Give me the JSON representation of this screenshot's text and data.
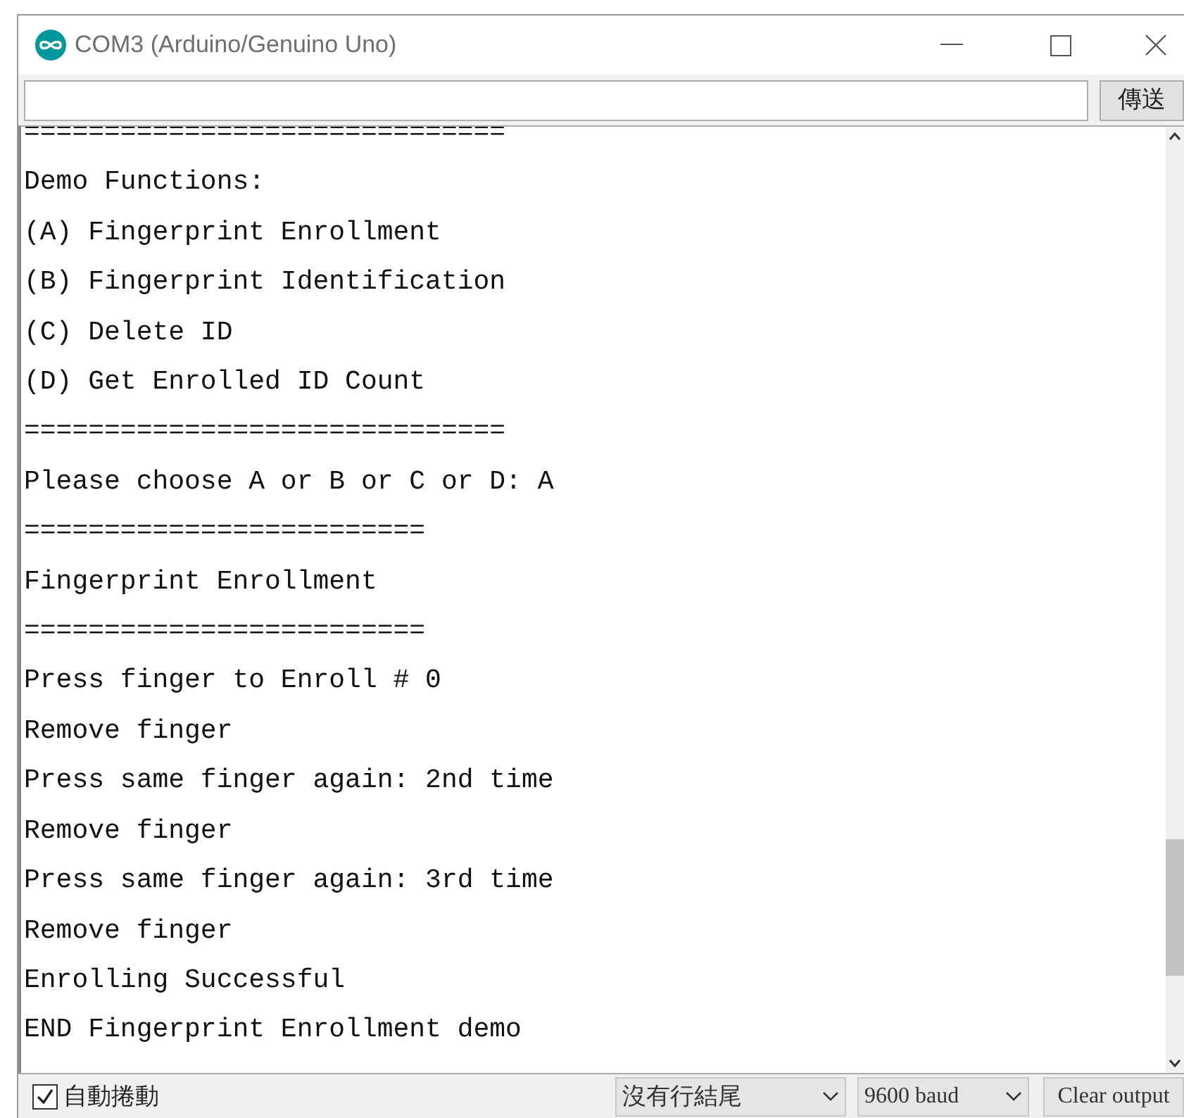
{
  "window": {
    "title": "COM3 (Arduino/Genuino Uno)"
  },
  "send_button": "傳送",
  "output_lines": [
    "==============================",
    "Demo Functions:",
    "(A) Fingerprint Enrollment",
    "(B) Fingerprint Identification",
    "(C) Delete ID",
    "(D) Get Enrolled ID Count",
    "==============================",
    "Please choose A or B or C or D: A",
    "=========================",
    "Fingerprint Enrollment",
    "=========================",
    "Press finger to Enroll # 0",
    "Remove finger",
    "Press same finger again: 2nd time",
    "Remove finger",
    "Press same finger again: 3rd time",
    "Remove finger",
    "Enrolling Successful",
    "END Fingerprint Enrollment demo"
  ],
  "status_bar": {
    "autoscroll": {
      "label": "自動捲動",
      "checked": true
    },
    "line_ending": "沒有行結尾",
    "baud": "9600 baud",
    "clear_button": "Clear output"
  }
}
